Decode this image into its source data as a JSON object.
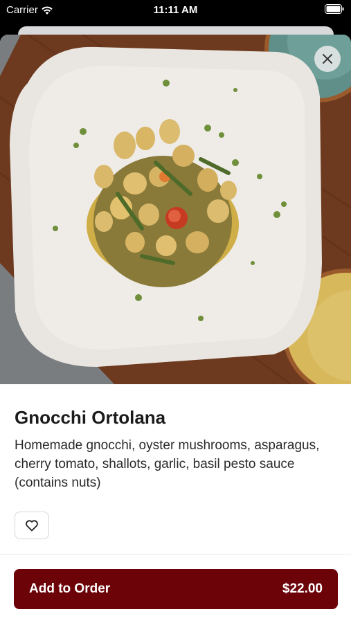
{
  "status_bar": {
    "carrier": "Carrier",
    "time": "11:11 AM"
  },
  "item": {
    "name": "Gnocchi Ortolana",
    "description": "Homemade gnocchi, oyster mushrooms, asparagus, cherry tomato, shallots, garlic, basil pesto sauce (contains nuts)"
  },
  "actions": {
    "add_label": "Add to Order",
    "price": "$22.00"
  },
  "icons": {
    "close": "close-icon",
    "favorite": "heart-icon",
    "wifi": "wifi-icon",
    "battery": "battery-icon"
  },
  "colors": {
    "primary": "#6c0309",
    "text": "#1b1b1b"
  }
}
